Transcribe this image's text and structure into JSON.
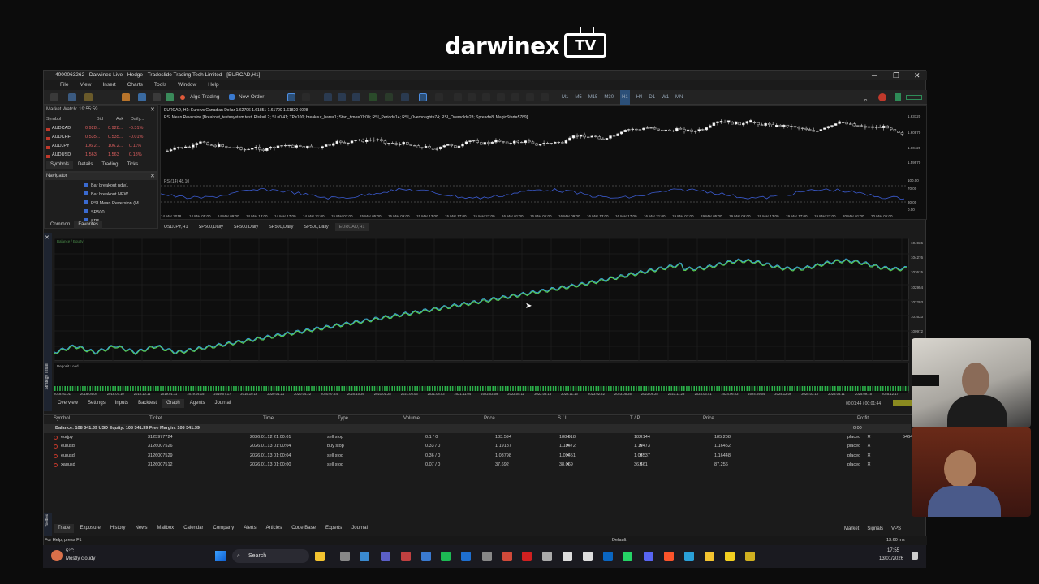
{
  "brand": {
    "word": "darwinex",
    "tv": "TV"
  },
  "window": {
    "title": "4000063262 - Darwinex-Live - Hedge - Tradeslide Trading Tech Limited - [EURCAD,H1]",
    "menu": [
      "File",
      "View",
      "Insert",
      "Charts",
      "Tools",
      "Window",
      "Help"
    ],
    "toolbar": {
      "algo_trading": "Algo Trading",
      "new_order": "New Order",
      "timeframes": [
        "M1",
        "M5",
        "M15",
        "M30",
        "H1",
        "H4",
        "D1",
        "W1",
        "MN"
      ],
      "active_tf": "H1"
    }
  },
  "market_watch": {
    "title": "Market Watch: 19:55:59",
    "columns": [
      "Symbol",
      "Bid",
      "Ask",
      "Daily..."
    ],
    "rows": [
      {
        "symbol": "AUDCAD",
        "bid": "0.928...",
        "ask": "0.928...",
        "daily": "-0.31%"
      },
      {
        "symbol": "AUDCHF",
        "bid": "0.535...",
        "ask": "0.535...",
        "daily": "-0.01%"
      },
      {
        "symbol": "AUDJPY",
        "bid": "106.2...",
        "ask": "106.2...",
        "daily": "0.11%"
      },
      {
        "symbol": "AUDUSD",
        "bid": "1.563",
        "ask": "1.563",
        "daily": "0.18%"
      }
    ],
    "tabs": [
      "Symbols",
      "Details",
      "Trading",
      "Ticks"
    ]
  },
  "navigator": {
    "title": "Navigator",
    "items": [
      "Bar breakout ndw1",
      "Bar breakout NEW",
      "RSI Mean Reversion (M",
      "SP500",
      "SP5"
    ],
    "tabs": [
      "Common",
      "Favorites"
    ]
  },
  "chart": {
    "header": "EURCAD, H1:  Euro vs Canadian Dollar  1.62706 1.61851 1.61700 1.61820  6028",
    "ea_line": "RSI Mean Reversion [Breakout_test=system test; Risk=0.2; SL=0.41; TP=100; breakout_bars=1; Start_time=01:00; RSI_Period=14; RSI_Overbought=74; RSI_Oversold=28; Spread=8; MagicStart=5789]",
    "price_labels": [
      "1.63120",
      "1.60870",
      "1.60420",
      "1.59970"
    ],
    "rsi_label": "RSI(14) 48.10",
    "rsi_levels": [
      "100.00",
      "70.00",
      "30.00",
      "0.00"
    ],
    "time_labels": [
      "14 Mar 2018",
      "14 Mar 05:00",
      "14 Mar 09:00",
      "14 Mar 13:00",
      "14 Mar 17:00",
      "14 Mar 21:00",
      "15 Mar 01:00",
      "15 Mar 05:00",
      "15 Mar 09:00",
      "15 Mar 13:00",
      "15 Mar 17:00",
      "15 Mar 21:00",
      "16 Mar 01:00",
      "16 Mar 05:00",
      "16 Mar 09:00",
      "16 Mar 13:00",
      "16 Mar 17:00",
      "16 Mar 21:00",
      "19 Mar 01:00",
      "19 Mar 05:00",
      "19 Mar 09:00",
      "19 Mar 13:00",
      "19 Mar 17:00",
      "19 Mar 21:00",
      "20 Mar 01:00",
      "20 Mar 05:00"
    ],
    "tabs": [
      "USDJPY,H1",
      "SP500,Daily",
      "SP500,Daily",
      "SP500,Daily",
      "SP500,Daily",
      "EURCAD,H1"
    ],
    "active_tab": "EURCAD,H1"
  },
  "tester": {
    "legend": "Balance / Equity",
    "balance_label": "Deposit Load",
    "y_labels": [
      "104936",
      "104276",
      "103615",
      "102954",
      "102293",
      "101633",
      "100972"
    ],
    "x_labels": [
      "2018.01.01",
      "2018.04.04",
      "2018.07.10",
      "2018.10.11",
      "2019.01.11",
      "2019.04.15",
      "2019.07.17",
      "2019.10.18",
      "2020.01.21",
      "2020.04.22",
      "2020.07.24",
      "2020.10.26",
      "2021.01.28",
      "2021.05.03",
      "2021.08.03",
      "2021.11.04",
      "2022.02.09",
      "2022.05.11",
      "2022.08.15",
      "2022.11.16",
      "2023.02.22",
      "2023.05.25",
      "2023.08.25",
      "2023.11.28",
      "2024.03.01",
      "2024.06.03",
      "2024.09.04",
      "2024.12.06",
      "2025.03.10",
      "2025.06.11",
      "2025.09.15",
      "2025.12.17"
    ],
    "tabs": [
      "Overview",
      "Settings",
      "Inputs",
      "Backtest",
      "Graph",
      "Agents",
      "Journal"
    ],
    "active_tab": "Graph",
    "timer": "00:01:44 / 00:01:44",
    "side_label": "Strategy Tester"
  },
  "toolbox": {
    "columns": [
      "Symbol",
      "Ticket",
      "Time",
      "Type",
      "Volume",
      "Price",
      "S / L",
      "T / P",
      "Price",
      "Profit"
    ],
    "balance_line": "Balance: 108 341.39 USD  Equity: 108 341.39  Free Margin: 108 341.39",
    "balance_profit": "0.00",
    "orders": [
      {
        "symbol": "eurjpy",
        "ticket": "3125977724",
        "time": "2026.01.12 21:00:01",
        "type": "sell stop",
        "volume": "0.1 / 0",
        "price": "183.594",
        "sl": "188.918",
        "tp": "182.144",
        "cur": "185.208",
        "profit": "placed"
      },
      {
        "symbol": "eurusd",
        "ticket": "3126007526",
        "time": "2026.01.13 01:00:04",
        "type": "buy stop",
        "volume": "0.33 / 0",
        "price": "1.19187",
        "sl": "1.18472",
        "tp": "1.19473",
        "cur": "1.16452",
        "profit": "placed"
      },
      {
        "symbol": "eurusd",
        "ticket": "3126007529",
        "time": "2026.01.13 01:00:04",
        "type": "sell stop",
        "volume": "0.36 / 0",
        "price": "1.08798",
        "sl": "1.09451",
        "tp": "1.08537",
        "cur": "1.16448",
        "profit": "placed"
      },
      {
        "symbol": "xagusd",
        "ticket": "3126007512",
        "time": "2026.01.13 01:00:00",
        "type": "sell stop",
        "volume": "0.07 / 0",
        "price": "37.692",
        "sl": "38.069",
        "tp": "36.561",
        "cur": "87.256",
        "profit": "placed"
      }
    ],
    "extra_value": "5464",
    "tabs": [
      "Trade",
      "Exposure",
      "History",
      "News",
      "Mailbox",
      "Calendar",
      "Company",
      "Alerts",
      "Articles",
      "Code Base",
      "Experts",
      "Journal"
    ],
    "right_links": [
      "Market",
      "Signals",
      "VPS"
    ],
    "side_label": "Toolbox"
  },
  "status": {
    "help": "For Help, press F1",
    "profile": "Default",
    "speed": "13.60 ms"
  },
  "taskbar": {
    "weather_temp": "5°C",
    "weather_desc": "Mostly cloudy",
    "search": "Search",
    "time": "17:55",
    "date": "13/01/2026"
  }
}
